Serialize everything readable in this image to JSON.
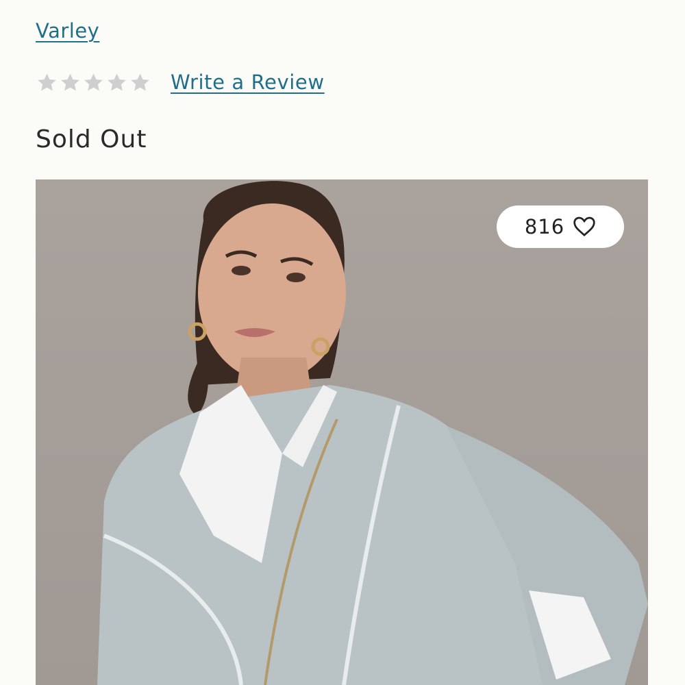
{
  "product": {
    "brand": "Varley",
    "rating": {
      "value": 0,
      "max": 5
    },
    "write_review_label": "Write a Review",
    "status": "Sold Out"
  },
  "image": {
    "likes": "816",
    "icons": {
      "like": "heart-icon",
      "rating": "star-icon"
    }
  },
  "colors": {
    "link": "#1f6f8b",
    "star_empty": "#cfcfcf",
    "background": "#fbfbf7"
  }
}
